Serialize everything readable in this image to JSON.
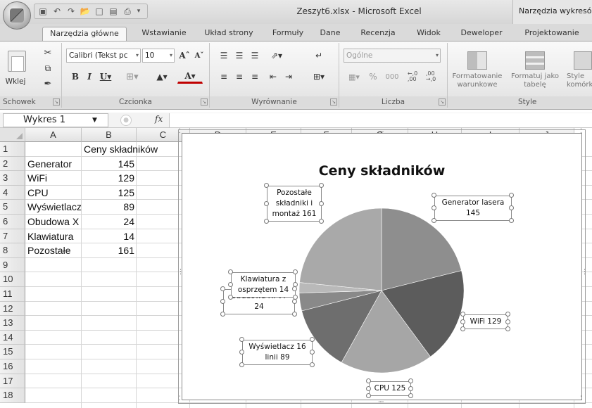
{
  "window": {
    "title": "Zeszyt6.xlsx - Microsoft Excel",
    "context_tools": "Narzędzia wykresów"
  },
  "tabs": [
    {
      "label": "Narzędzia główne",
      "active": true
    },
    {
      "label": "Wstawianie"
    },
    {
      "label": "Układ strony"
    },
    {
      "label": "Formuły"
    },
    {
      "label": "Dane"
    },
    {
      "label": "Recenzja"
    },
    {
      "label": "Widok"
    },
    {
      "label": "Deweloper"
    },
    {
      "label": "Projektowanie"
    }
  ],
  "ribbon": {
    "clipboard": {
      "label": "Schowek",
      "paste": "Wklej"
    },
    "font": {
      "label": "Czcionka",
      "font_name": "Calibri (Tekst pc",
      "font_size": "10"
    },
    "alignment": {
      "label": "Wyrównanie"
    },
    "number": {
      "label": "Liczba",
      "format": "Ogólne"
    },
    "style": {
      "label": "Style",
      "conditional": "Formatowanie warunkowe",
      "table": "Formatuj jako tabelę",
      "cell_styles": "Style komórki"
    }
  },
  "formula_bar": {
    "name_box": "Wykres 1",
    "fx": "fx",
    "value": ""
  },
  "columns": [
    "A",
    "B",
    "C",
    "D",
    "E",
    "F",
    "G",
    "H",
    "I",
    "J"
  ],
  "rows": [
    "1",
    "2",
    "3",
    "4",
    "5",
    "6",
    "7",
    "8",
    "9",
    "10",
    "11",
    "12",
    "13",
    "14",
    "15",
    "16",
    "17",
    "18"
  ],
  "cells": {
    "header": "Ceny składników",
    "items": [
      {
        "name": "Generator",
        "value": "145"
      },
      {
        "name": "WiFi",
        "value": "129"
      },
      {
        "name": "CPU",
        "value": "125"
      },
      {
        "name": "Wyświetlacz",
        "value": "89"
      },
      {
        "name": "Obudowa X",
        "value": "24"
      },
      {
        "name": "Klawiatura",
        "value": "14"
      },
      {
        "name": "Pozostałe",
        "value": "161"
      }
    ]
  },
  "chart_data": {
    "type": "pie",
    "title": "Ceny składników",
    "categories": [
      "Generator lasera",
      "WiFi",
      "CPU",
      "Wyświetlacz 16 linii",
      "Obudowa XFV7",
      "Klawiatura z osprzętem",
      "Pozostałe składniki i montaż"
    ],
    "values": [
      145,
      129,
      125,
      89,
      24,
      14,
      161
    ],
    "colors": [
      "#8e8e8e",
      "#5c5c5c",
      "#a6a6a6",
      "#6e6e6e",
      "#898989",
      "#b9b9b9",
      "#a9a9a9"
    ],
    "data_labels": [
      "Generator lasera 145",
      "WiFi 129",
      "CPU 125",
      "Wyświetlacz 16 linii 89",
      "Obudowa XFV7 24",
      "Klawiatura z osprzętem 14",
      "Pozostałe składniki i montaż 161"
    ],
    "legend": "none"
  }
}
